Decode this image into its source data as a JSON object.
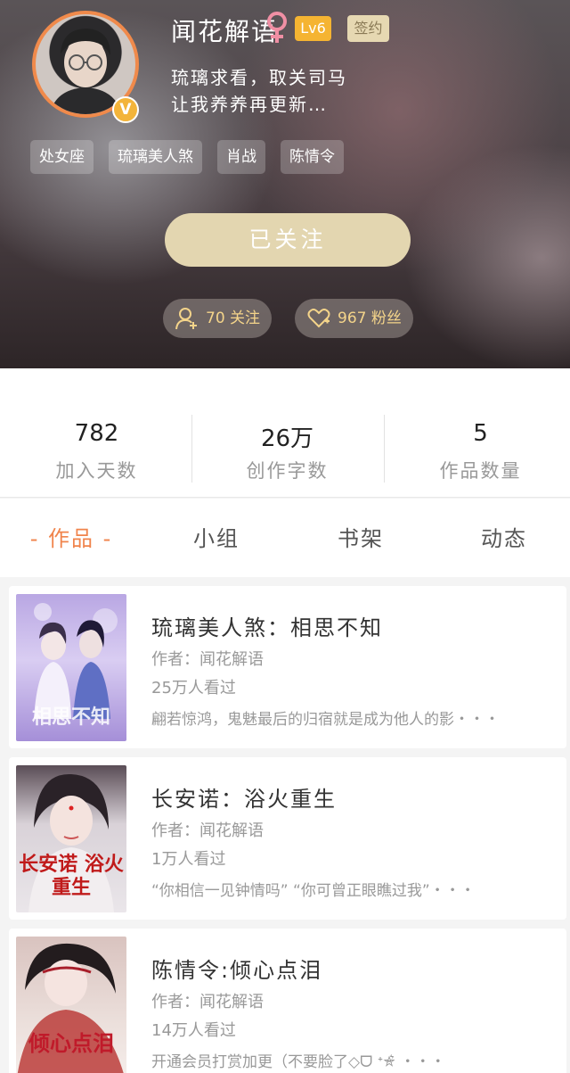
{
  "profile": {
    "username": "闻花解语",
    "level": "Lv6",
    "signed_label": "签约",
    "verified_badge": "V",
    "bio_lines": [
      "琉璃求看，取关司马",
      "让我养养再更新…"
    ],
    "tags": [
      "处女座",
      "琉璃美人煞",
      "肖战",
      "陈情令"
    ],
    "follow_button": "已关注",
    "following": "70 关注",
    "fans": "967 粉丝",
    "icons": {
      "gender": "female-icon",
      "following": "add-user-icon",
      "fans": "heart-icon"
    },
    "colors": {
      "accent": "#f0844c",
      "level": "#f5b432",
      "follow_button": "#e3d6b0",
      "pill_text": "#f4d48a"
    }
  },
  "stats": [
    {
      "value": "782",
      "label": "加入天数"
    },
    {
      "value": "26万",
      "label": "创作字数"
    },
    {
      "value": "5",
      "label": "作品数量"
    }
  ],
  "tabs": [
    {
      "label": "- 作品 -",
      "active": true
    },
    {
      "label": "小组",
      "active": false
    },
    {
      "label": "书架",
      "active": false
    },
    {
      "label": "动态",
      "active": false
    }
  ],
  "books": [
    {
      "title": "琉璃美人煞：相思不知",
      "author": "作者：闻花解语",
      "views": "25万人看过",
      "desc": "翩若惊鸿，鬼魅最后的归宿就是成为他人的影・・・",
      "cover_text": "相思不知"
    },
    {
      "title": "长安诺：浴火重生",
      "author": "作者：闻花解语",
      "views": "1万人看过",
      "desc": "“你相信一见钟情吗” “你可曾正眼瞧过我”・・・",
      "cover_text": "长安诺 浴火重生"
    },
    {
      "title": "陈情令:倾心点泪",
      "author": "作者：闻花解语",
      "views": "14万人看过",
      "desc": "开通会员打赏加更（不要脸了◇ᗜ ᕀ☆̵͛ ・・・",
      "cover_text": "倾心点泪"
    }
  ]
}
